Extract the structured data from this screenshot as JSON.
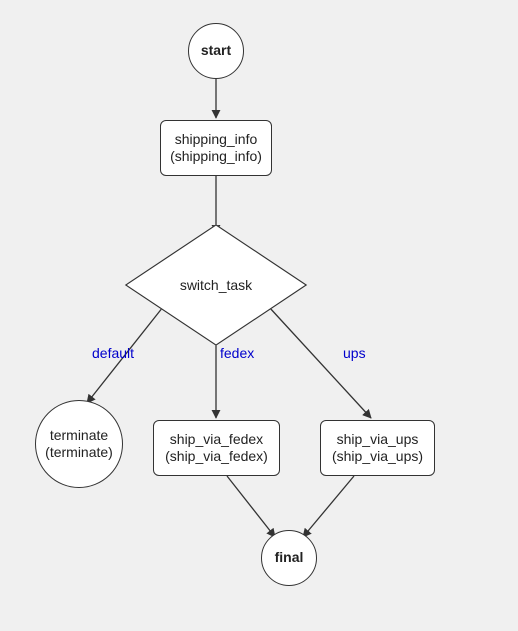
{
  "diagram": {
    "nodes": {
      "start": {
        "label": "start"
      },
      "shipping_info": {
        "line1": "shipping_info",
        "line2": "(shipping_info)"
      },
      "switch_task": {
        "label": "switch_task"
      },
      "terminate": {
        "line1": "terminate",
        "line2": "(terminate)"
      },
      "ship_via_fedex": {
        "line1": "ship_via_fedex",
        "line2": "(ship_via_fedex)"
      },
      "ship_via_ups": {
        "line1": "ship_via_ups",
        "line2": "(ship_via_ups)"
      },
      "final": {
        "label": "final"
      }
    },
    "edges": {
      "default": {
        "label": "default"
      },
      "fedex": {
        "label": "fedex"
      },
      "ups": {
        "label": "ups"
      }
    }
  },
  "chart_data": {
    "type": "flowchart",
    "title": "",
    "nodes": [
      {
        "id": "start",
        "shape": "circle",
        "label": "start"
      },
      {
        "id": "shipping_info",
        "shape": "rect",
        "label": "shipping_info (shipping_info)"
      },
      {
        "id": "switch_task",
        "shape": "diamond",
        "label": "switch_task"
      },
      {
        "id": "terminate",
        "shape": "circle",
        "label": "terminate (terminate)"
      },
      {
        "id": "ship_via_fedex",
        "shape": "rect",
        "label": "ship_via_fedex (ship_via_fedex)"
      },
      {
        "id": "ship_via_ups",
        "shape": "rect",
        "label": "ship_via_ups (ship_via_ups)"
      },
      {
        "id": "final",
        "shape": "circle",
        "label": "final"
      }
    ],
    "edges": [
      {
        "from": "start",
        "to": "shipping_info",
        "label": ""
      },
      {
        "from": "shipping_info",
        "to": "switch_task",
        "label": ""
      },
      {
        "from": "switch_task",
        "to": "terminate",
        "label": "default"
      },
      {
        "from": "switch_task",
        "to": "ship_via_fedex",
        "label": "fedex"
      },
      {
        "from": "switch_task",
        "to": "ship_via_ups",
        "label": "ups"
      },
      {
        "from": "ship_via_fedex",
        "to": "final",
        "label": ""
      },
      {
        "from": "ship_via_ups",
        "to": "final",
        "label": ""
      }
    ]
  }
}
